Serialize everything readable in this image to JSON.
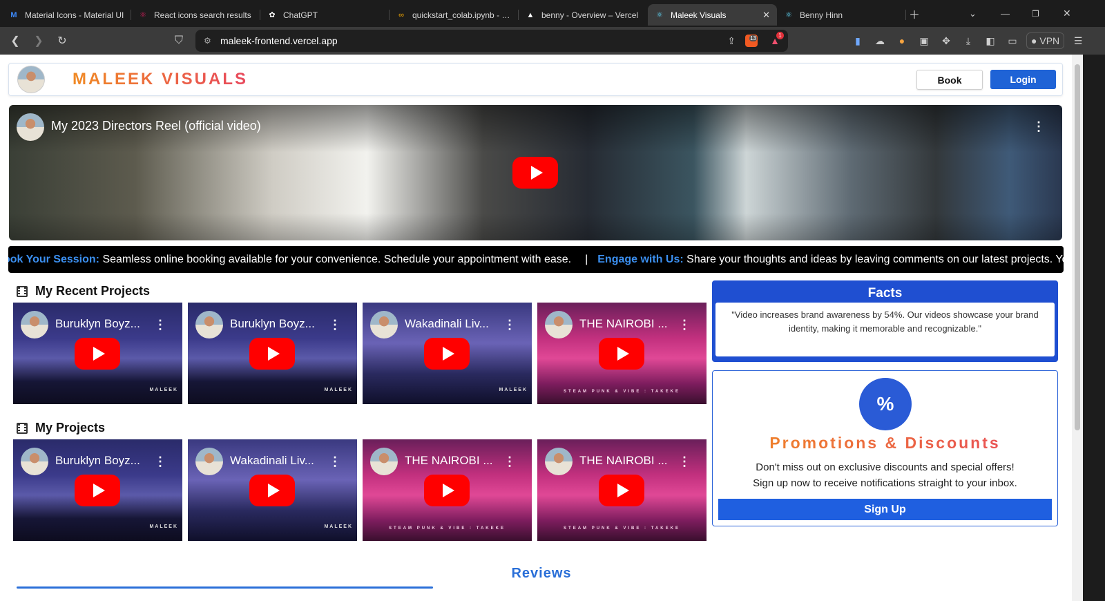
{
  "browser": {
    "tabs": [
      {
        "title": "Material Icons - Material UI",
        "icon": "material-ui-icon",
        "color": "#3d8bfd"
      },
      {
        "title": "React icons search results",
        "icon": "react-icons-icon",
        "color": "#e91e63"
      },
      {
        "title": "ChatGPT",
        "icon": "chatgpt-icon",
        "color": "#ffffff"
      },
      {
        "title": "quickstart_colab.ipynb - Co",
        "icon": "colab-icon",
        "color": "#f9ab00"
      },
      {
        "title": "benny - Overview – Vercel",
        "icon": "vercel-icon",
        "color": "#ffffff"
      },
      {
        "title": "Maleek Visuals",
        "icon": "react-icon",
        "color": "#61dafb",
        "active": true
      },
      {
        "title": "Benny Hinn",
        "icon": "react-icon",
        "color": "#61dafb"
      }
    ],
    "url": "maleek-frontend.vercel.app",
    "brave_badge": "13",
    "alert_badge": "1",
    "vpn_label": "VPN"
  },
  "site": {
    "brand": "MALEEK VISUALS",
    "book_label": "Book",
    "login_label": "Login"
  },
  "hero": {
    "title": "My 2023 Directors Reel (official video)"
  },
  "marquee": {
    "items": [
      {
        "keyword": "ook Your Session:",
        "text": " Seamless online booking available for your convenience. Schedule your appointment with ease."
      },
      {
        "keyword": "Engage with Us:",
        "text": " Share your thoughts and ideas by leaving comments on our latest projects. Your fee"
      }
    ],
    "separator": "|"
  },
  "recent_projects": {
    "title": "My Recent Projects",
    "videos": [
      {
        "title": "Buruklyn Boyz...",
        "style": "crowd",
        "watermark": "MALEEK"
      },
      {
        "title": "Buruklyn Boyz...",
        "style": "crowd",
        "watermark": "MALEEK"
      },
      {
        "title": "Wakadinali Liv...",
        "style": "purple",
        "watermark": "MALEEK"
      },
      {
        "title": "THE NAIROBI ...",
        "style": "pink",
        "watermark": "STEAM PUNK & VIBE : TAKEKE"
      }
    ]
  },
  "projects": {
    "title": "My Projects",
    "videos": [
      {
        "title": "Buruklyn Boyz...",
        "style": "crowd",
        "watermark": "MALEEK"
      },
      {
        "title": "Wakadinali Liv...",
        "style": "purple",
        "watermark": "MALEEK"
      },
      {
        "title": "THE NAIROBI ...",
        "style": "pink",
        "watermark": "STEAM PUNK & VIBE : TAKEKE"
      },
      {
        "title": "THE NAIROBI ...",
        "style": "pink",
        "watermark": "STEAM PUNK & VIBE : TAKEKE"
      }
    ]
  },
  "facts": {
    "title": "Facts",
    "text": "\"Video increases brand awareness by 54%. Our videos showcase your brand identity, making it memorable and recognizable.\""
  },
  "promo": {
    "badge": "%",
    "title": "Promotions & Discounts",
    "line1": "Don't miss out on exclusive discounts and special offers!",
    "line2": "Sign up now to receive notifications straight to your inbox.",
    "signup_label": "Sign Up"
  },
  "reviews": {
    "title": "Reviews"
  },
  "colors": {
    "accent_blue": "#1f5fe0",
    "brand_gradient_start": "#f08a24",
    "brand_gradient_end": "#e8485d",
    "youtube_red": "#ff0000"
  }
}
